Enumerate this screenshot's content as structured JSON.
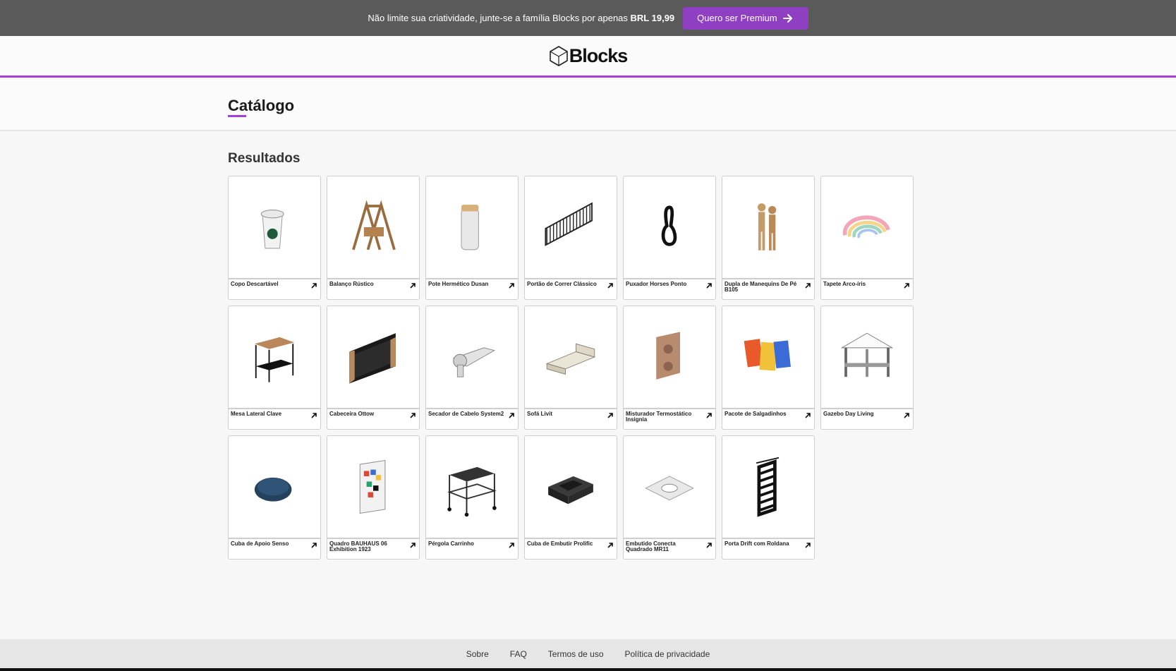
{
  "promo": {
    "text": "Não limite sua criatividade, junte-se a família Blocks por apenas",
    "price": "BRL 19,99",
    "button_label": "Quero ser Premium",
    "button_icon": "arrow-right-icon",
    "button_color": "#8e3fc2"
  },
  "header": {
    "logo_text": "Blocks",
    "logo_icon": "cube-icon",
    "accent_color": "#a53fd9"
  },
  "page": {
    "title": "Catálogo"
  },
  "results": {
    "heading": "Resultados",
    "items": [
      {
        "name": "Copo Descartável"
      },
      {
        "name": "Balanço Rústico"
      },
      {
        "name": "Pote Hermético Dusan"
      },
      {
        "name": "Portão de Correr Clássico"
      },
      {
        "name": "Puxador Horses Ponto"
      },
      {
        "name": "Dupla de Manequins De Pé B105"
      },
      {
        "name": "Tapete Arco-íris"
      },
      {
        "name": "Mesa Lateral Clave"
      },
      {
        "name": "Cabeceira Ottow"
      },
      {
        "name": "Secador de Cabelo System2"
      },
      {
        "name": "Sofá Livit"
      },
      {
        "name": "Misturador Termostático Insignia"
      },
      {
        "name": "Pacote de Salgadinhos"
      },
      {
        "name": "Gazebo Day Living"
      },
      {
        "name": "Cuba de Apoio Senso"
      },
      {
        "name": "Quadro BAUHAUS 06 Exhibition 1923"
      },
      {
        "name": "Pérgola Carrinho"
      },
      {
        "name": "Cuba de Embutir Prolific"
      },
      {
        "name": "Embutido Conecta Quadrado MR11"
      },
      {
        "name": "Porta Drift com Roldana"
      }
    ]
  },
  "footer": {
    "links": [
      "Sobre",
      "FAQ",
      "Termos de uso",
      "Política de privacidade"
    ]
  }
}
